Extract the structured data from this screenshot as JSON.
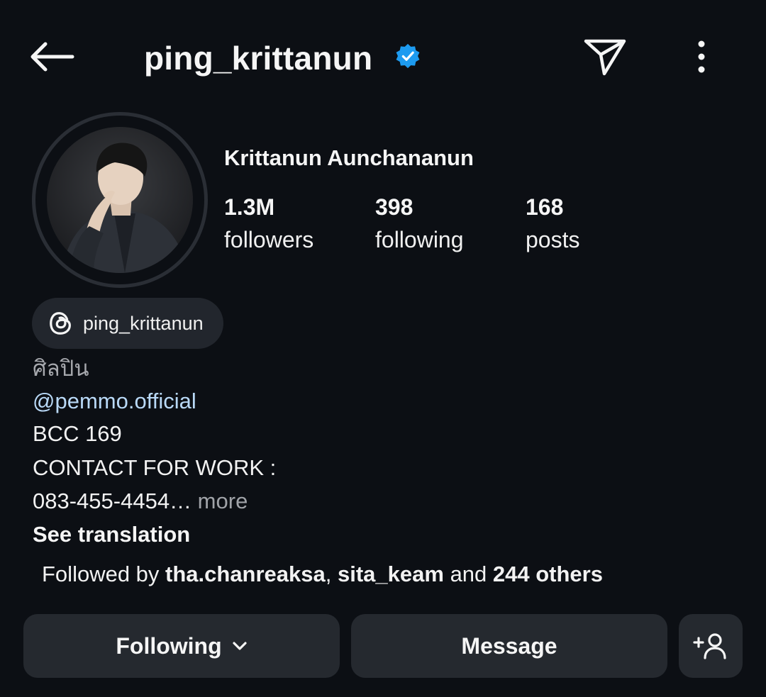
{
  "header": {
    "username": "ping_krittanun",
    "verified": true,
    "icons": [
      "back-arrow-icon",
      "verified-badge-icon",
      "send-icon",
      "more-vertical-icon"
    ]
  },
  "profile": {
    "full_name": "Krittanun Aunchananun",
    "stats": [
      {
        "value": "1.3M",
        "label": "followers"
      },
      {
        "value": "398",
        "label": "following"
      },
      {
        "value": "168",
        "label": "posts"
      }
    ]
  },
  "threads": {
    "handle": "ping_krittanun",
    "icon": "threads-icon"
  },
  "bio": {
    "category": "ศิลปิน",
    "mention": "@pemmo.official",
    "line3": "BCC 169",
    "line4": "CONTACT FOR WORK :",
    "line5": "083-455-4454…",
    "more_label": " more",
    "see_translation": "See translation"
  },
  "followed_by": {
    "prefix": "Followed by ",
    "user1": "tha.chanreaksa",
    "separator": ", ",
    "user2": "sita_keam",
    "middle": " and ",
    "others": "244 others"
  },
  "actions": {
    "following_label": "Following",
    "message_label": "Message",
    "add_user_icon": "add-person-icon"
  },
  "colors": {
    "background": "#0c0f14",
    "verified_blue": "#1d9bf0",
    "button_bg": "#25292f",
    "mention_blue": "#b9d9f7"
  }
}
